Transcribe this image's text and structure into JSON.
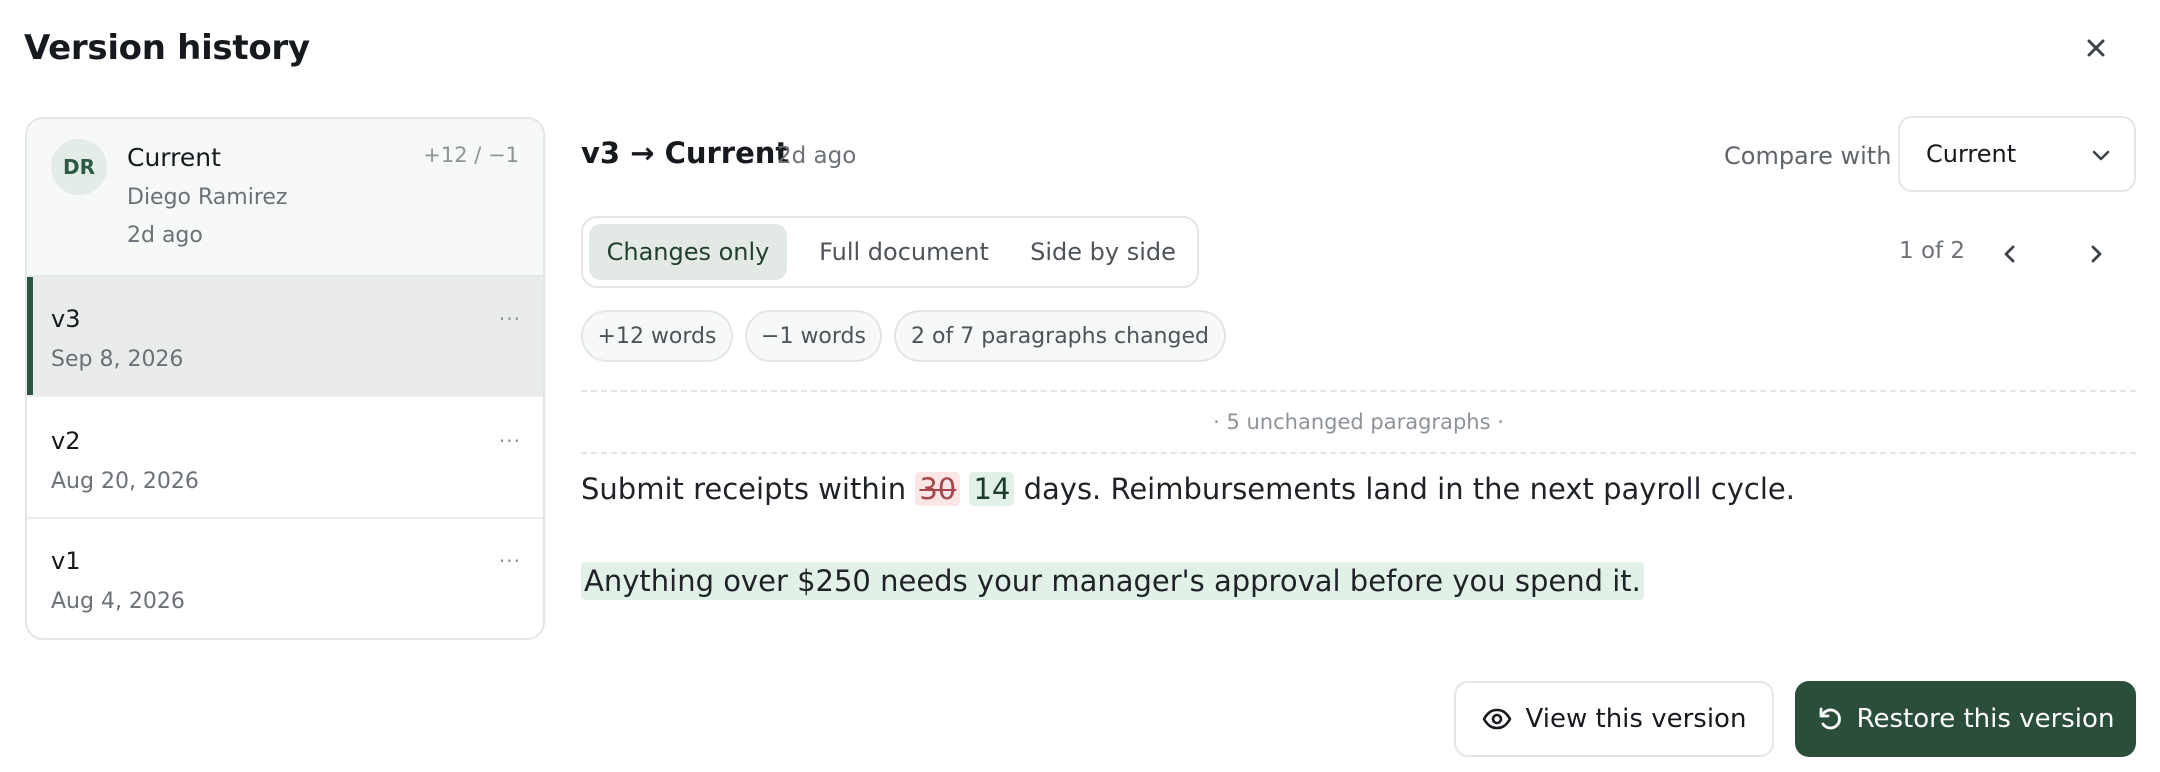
{
  "dialog": {
    "title": "Version history",
    "close_icon": "close-icon"
  },
  "sidebar": {
    "current": {
      "avatar_initials": "DR",
      "name": "Current",
      "author": "Diego Ramirez",
      "time": "2d ago",
      "delta": "+12 / −1"
    },
    "versions": [
      {
        "label": "v3",
        "date": "Sep 8, 2026",
        "more": "···",
        "selected": true
      },
      {
        "label": "v2",
        "date": "Aug 20, 2026",
        "more": "···",
        "selected": false
      },
      {
        "label": "v1",
        "date": "Aug 4, 2026",
        "more": "···",
        "selected": false
      }
    ]
  },
  "main": {
    "diff_title": "v3 → Current",
    "diff_time": "2d ago",
    "compare_label": "Compare with",
    "compare_value": "Current",
    "view_tabs": [
      {
        "label": "Changes only",
        "active": true
      },
      {
        "label": "Full document",
        "active": false
      },
      {
        "label": "Side by side",
        "active": false
      }
    ],
    "pager": {
      "text": "1 of 2"
    },
    "stats": [
      "+12 words",
      "−1 words",
      "2 of 7 paragraphs changed"
    ],
    "unchanged_note": "· 5 unchanged paragraphs ·",
    "paragraph1": {
      "before": "Submit receipts within ",
      "deleted": "30",
      "inserted": "14",
      "after": " days. Reimbursements land in the next payroll cycle."
    },
    "paragraph2": {
      "inserted": "Anything over $250 needs your manager's approval before you spend it."
    }
  },
  "actions": {
    "view_label": "View this version",
    "restore_label": "Restore this version"
  },
  "colors": {
    "accent": "#2b4e3b",
    "deleted_bg": "#fbe5e5",
    "inserted_bg": "#e1f1e7"
  }
}
